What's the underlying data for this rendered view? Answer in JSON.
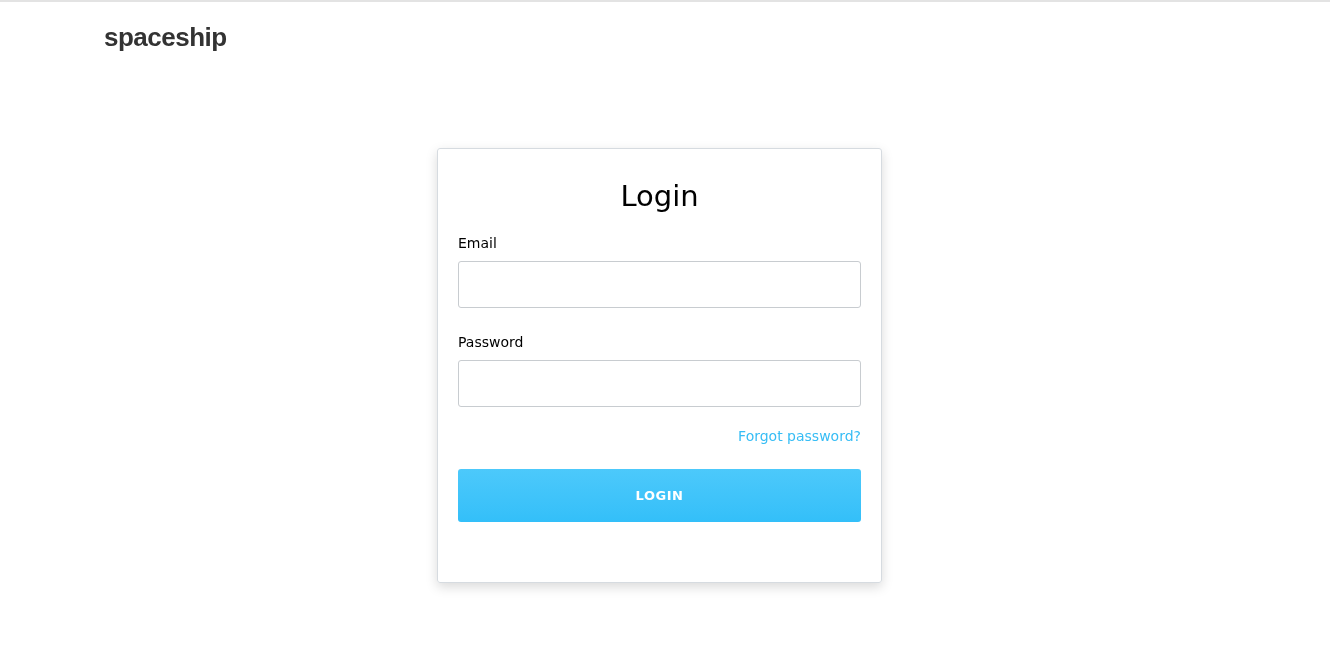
{
  "header": {
    "logo": "spaceship"
  },
  "form": {
    "title": "Login",
    "fields": [
      {
        "label": "Email"
      },
      {
        "label": "Password"
      }
    ],
    "forgot_link": "Forgot password?",
    "submit": "LOGIN"
  }
}
